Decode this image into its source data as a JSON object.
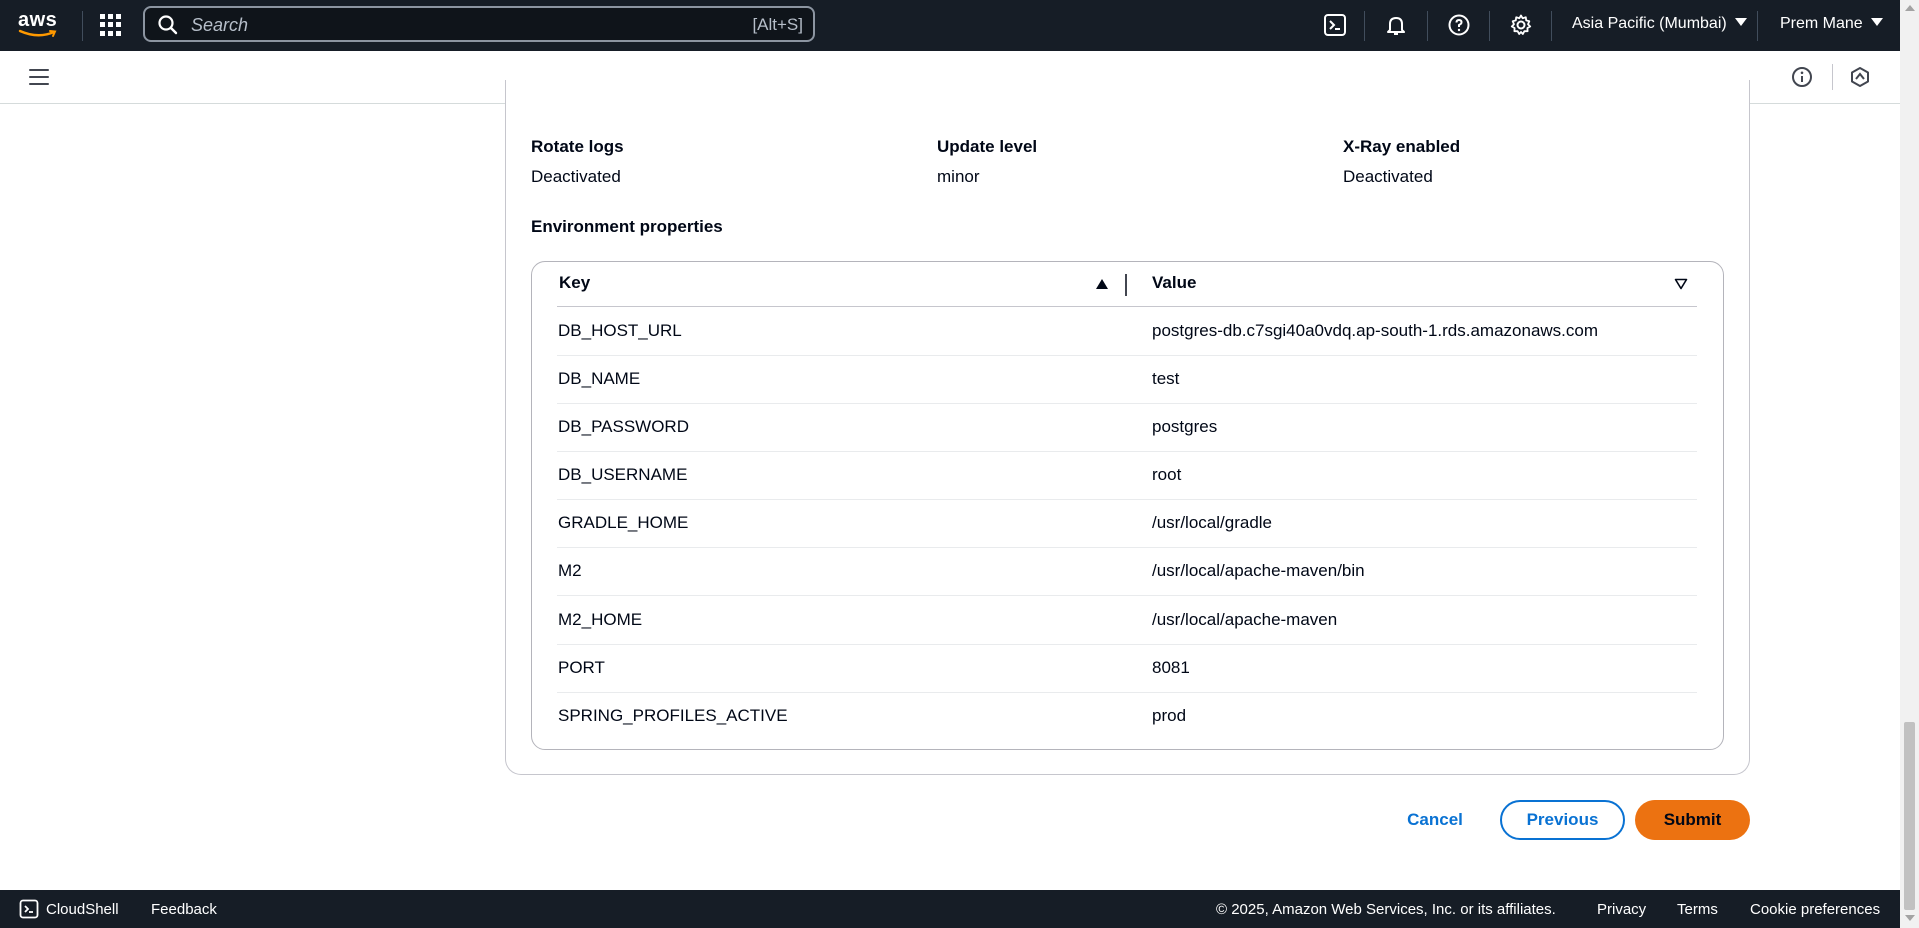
{
  "topnav": {
    "logo_text": "aws",
    "search_placeholder": "Search",
    "search_shortcut": "[Alt+S]",
    "region": "Asia Pacific (Mumbai)",
    "user": "Prem Mane"
  },
  "details": [
    {
      "label": "Rotate logs",
      "value": "Deactivated"
    },
    {
      "label": "Update level",
      "value": "minor"
    },
    {
      "label": "X-Ray enabled",
      "value": "Deactivated"
    }
  ],
  "env_section_title": "Environment properties",
  "table": {
    "columns": [
      "Key",
      "Value"
    ],
    "rows": [
      {
        "key": "DB_HOST_URL",
        "value": "postgres-db.c7sgi40a0vdq.ap-south-1.rds.amazonaws.com"
      },
      {
        "key": "DB_NAME",
        "value": "test"
      },
      {
        "key": "DB_PASSWORD",
        "value": "postgres"
      },
      {
        "key": "DB_USERNAME",
        "value": "root"
      },
      {
        "key": "GRADLE_HOME",
        "value": "/usr/local/gradle"
      },
      {
        "key": "M2",
        "value": "/usr/local/apache-maven/bin"
      },
      {
        "key": "M2_HOME",
        "value": "/usr/local/apache-maven"
      },
      {
        "key": "PORT",
        "value": "8081"
      },
      {
        "key": "SPRING_PROFILES_ACTIVE",
        "value": "prod"
      }
    ]
  },
  "actions": {
    "cancel": "Cancel",
    "previous": "Previous",
    "submit": "Submit"
  },
  "footer": {
    "cloudshell": "CloudShell",
    "feedback": "Feedback",
    "copyright": "© 2025, Amazon Web Services, Inc. or its affiliates.",
    "privacy": "Privacy",
    "terms": "Terms",
    "cookies": "Cookie preferences"
  },
  "colors": {
    "nav_bg": "#161d26",
    "link_blue": "#0972d3",
    "submit_orange": "#ec7211"
  }
}
